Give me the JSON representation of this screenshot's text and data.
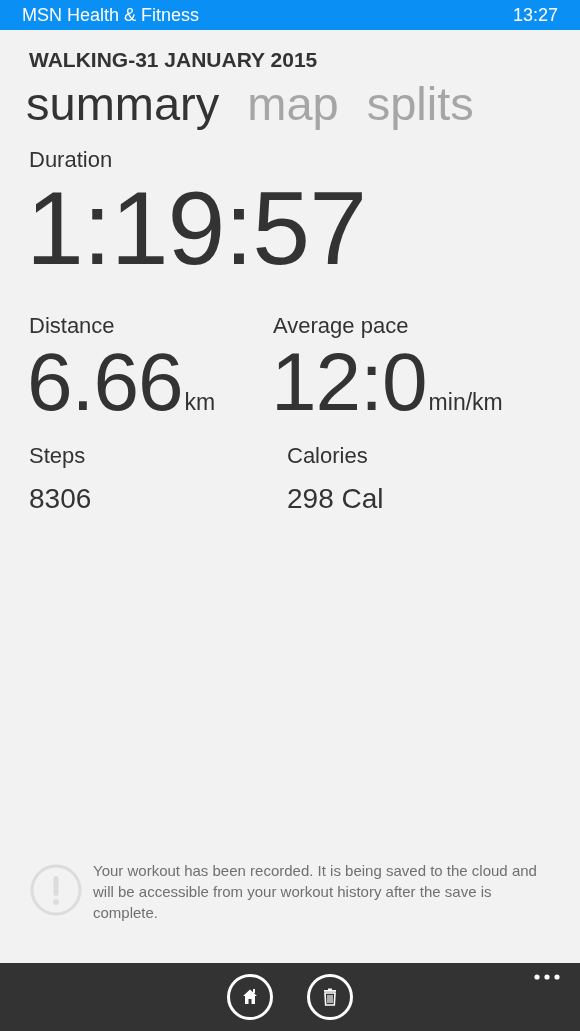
{
  "status_bar": {
    "app_name": "MSN Health & Fitness",
    "time": "13:27"
  },
  "title": "WALKING-31 JANUARY 2015",
  "tabs": [
    {
      "label": "summary",
      "selected": true
    },
    {
      "label": "map",
      "selected": false
    },
    {
      "label": "splits",
      "selected": false
    }
  ],
  "duration": {
    "label": "Duration",
    "value": "1:19:57"
  },
  "stats": [
    {
      "kind": "large",
      "label": "Distance",
      "value": "6.66",
      "unit": "km"
    },
    {
      "kind": "large",
      "label": "Average pace",
      "value": "12:0",
      "unit": "min/km"
    },
    {
      "kind": "small",
      "label": "Steps",
      "value": "8306"
    },
    {
      "kind": "small",
      "label": "Calories",
      "value": "298 Cal"
    }
  ],
  "notice": "Your workout has been recorded. It is being saved to the cloud and will be accessible from your workout history after the save is complete.",
  "app_bar": {
    "buttons": [
      {
        "kind": "home"
      },
      {
        "kind": "delete"
      }
    ]
  }
}
